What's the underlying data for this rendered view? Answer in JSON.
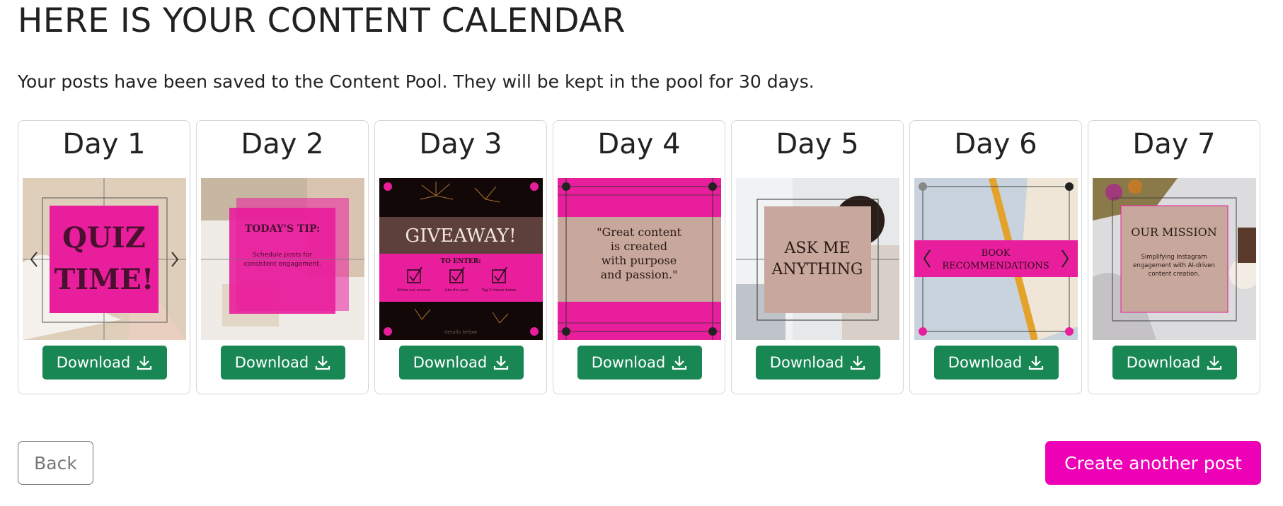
{
  "header": {
    "title": "HERE IS YOUR CONTENT CALENDAR",
    "subtitle": "Your posts have been saved to the Content Pool. They will be kept in the pool for 30 days."
  },
  "download_label": "Download",
  "colors": {
    "accent_pink": "#ee00b6",
    "download_green": "#198754",
    "post_pink": "#e91e9c",
    "post_tan": "#c8a89c"
  },
  "days": [
    {
      "label": "Day 1",
      "post": {
        "lines": [
          "QUIZ",
          "TIME!"
        ]
      }
    },
    {
      "label": "Day 2",
      "post": {
        "heading": "TODAY'S TIP:",
        "body": [
          "Schedule posts for",
          "consistent engagement."
        ]
      }
    },
    {
      "label": "Day 3",
      "post": {
        "heading": "GIVEAWAY!",
        "sub": "TO ENTER:",
        "steps": [
          "Follow our account",
          "Like this post",
          "Tag 3 friends below"
        ],
        "footer": "details below"
      }
    },
    {
      "label": "Day 4",
      "post": {
        "lines": [
          "\"Great content",
          "is created",
          "with purpose",
          "and passion.\""
        ]
      }
    },
    {
      "label": "Day 5",
      "post": {
        "lines": [
          "ASK ME",
          "ANYTHING"
        ]
      }
    },
    {
      "label": "Day 6",
      "post": {
        "lines": [
          "BOOK",
          "RECOMMENDATIONS"
        ]
      }
    },
    {
      "label": "Day 7",
      "post": {
        "heading": "OUR MISSION",
        "body": [
          "Simplifying Instagram",
          "engagement with AI-driven",
          "content creation."
        ]
      }
    }
  ],
  "footer": {
    "back_label": "Back",
    "create_label": "Create another post"
  }
}
